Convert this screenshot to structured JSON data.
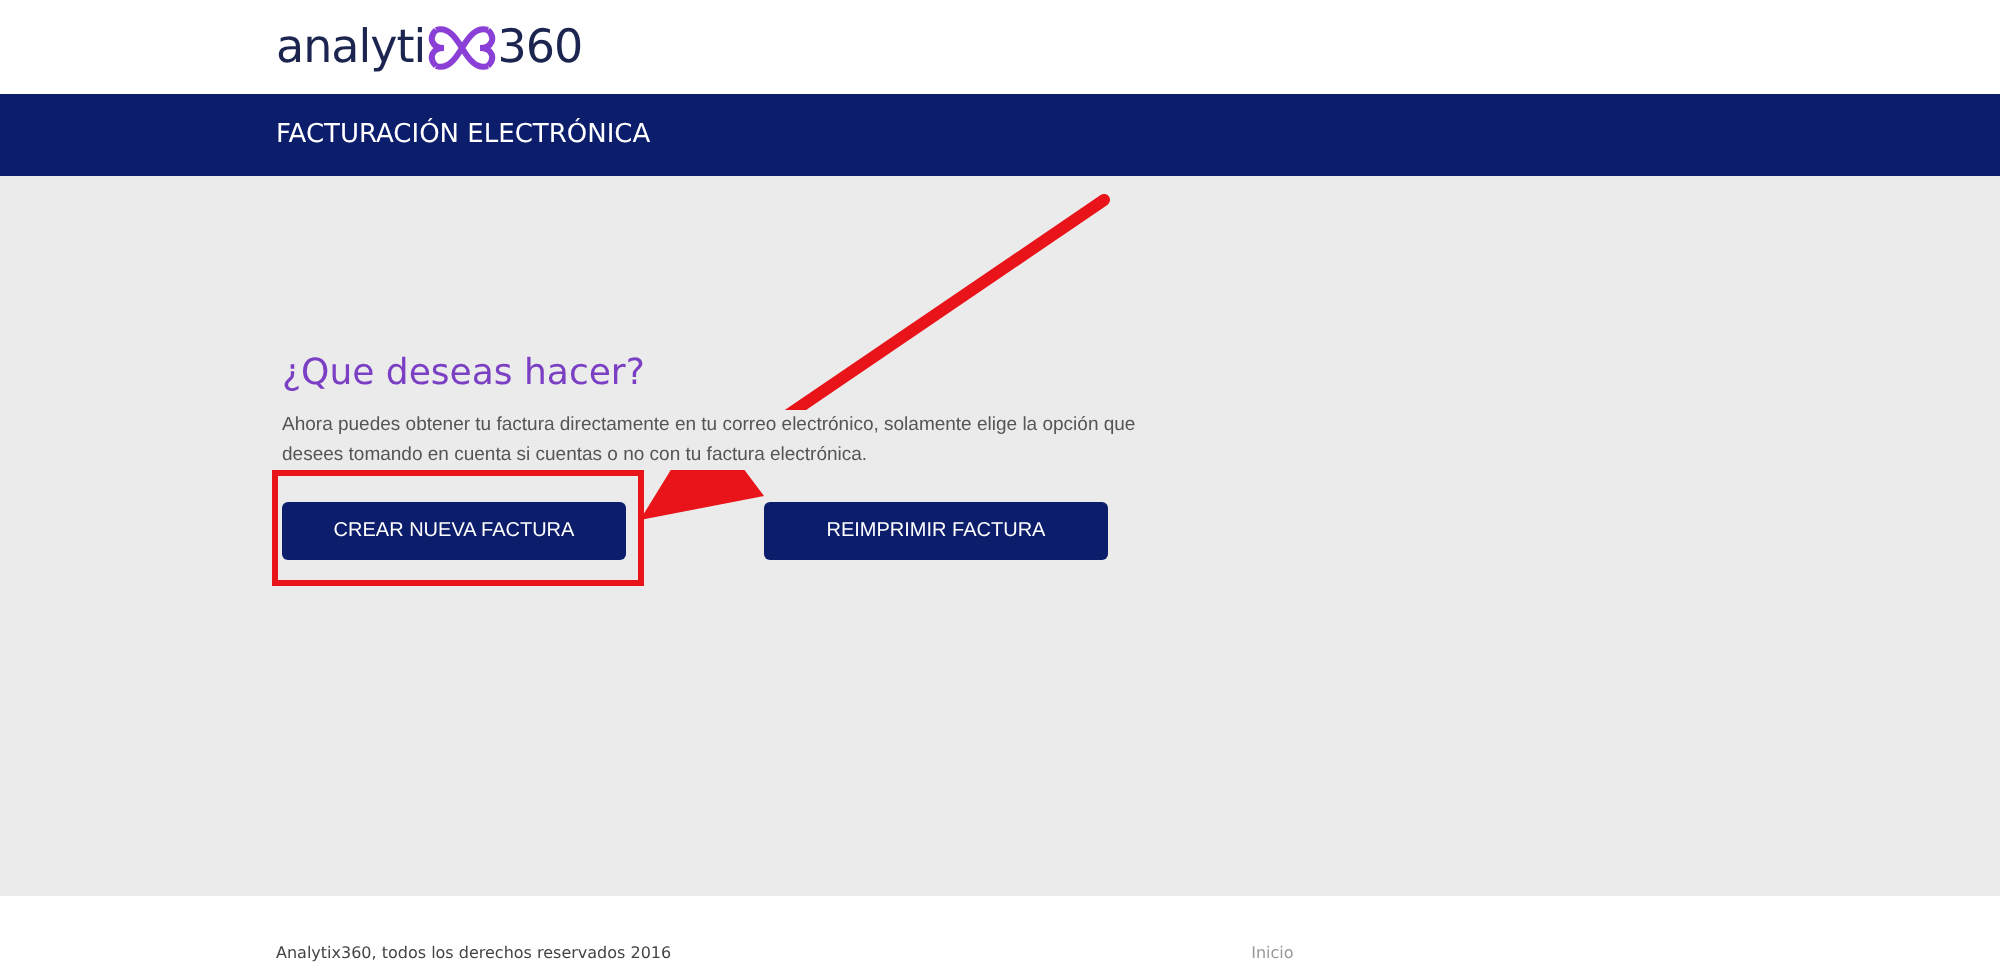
{
  "logo": {
    "text_before": "analyti",
    "text_after": "360"
  },
  "nav_bar": {
    "title": "FACTURACIÓN ELECTRÓNICA"
  },
  "main": {
    "heading": "¿Que deseas hacer?",
    "description": "Ahora puedes obtener tu factura directamente en tu correo electrónico, solamente elige la opción que desees tomando en cuenta si cuentas o no con tu factura electrónica.",
    "buttons": [
      {
        "label": "CREAR NUEVA FACTURA",
        "highlighted": true
      },
      {
        "label": "REIMPRIMIR FACTURA",
        "highlighted": false
      }
    ]
  },
  "footer": {
    "copyright": "Analytix360, todos los derechos reservados 2016",
    "link": "Inicio"
  }
}
